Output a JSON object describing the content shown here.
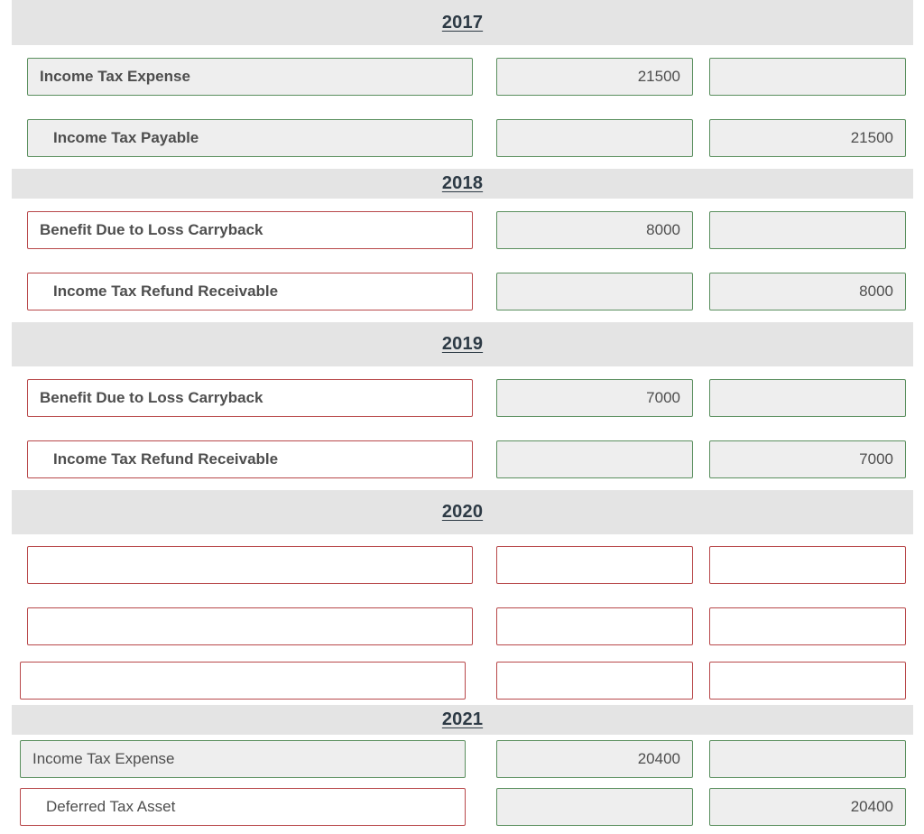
{
  "colors": {
    "correct_border": "#5a8f5e",
    "incorrect_border": "#b8484a",
    "band_background": "#e4e4e4",
    "filled_background": "#eeeeee"
  },
  "sections": [
    {
      "year": "2017",
      "entries": [
        {
          "account": "Income Tax Expense",
          "debit": "21500",
          "credit": "",
          "account_status": "correct",
          "debit_status": "correct",
          "credit_status": "correct"
        },
        {
          "account": "Income Tax Payable",
          "debit": "",
          "credit": "21500",
          "account_status": "correct",
          "debit_status": "correct",
          "credit_status": "correct"
        }
      ]
    },
    {
      "year": "2018",
      "entries": [
        {
          "account": "Benefit Due to Loss Carryback",
          "debit": "8000",
          "credit": "",
          "account_status": "incorrect",
          "debit_status": "correct",
          "credit_status": "correct"
        },
        {
          "account": "Income Tax Refund Receivable",
          "debit": "",
          "credit": "8000",
          "account_status": "incorrect",
          "debit_status": "correct",
          "credit_status": "correct"
        }
      ]
    },
    {
      "year": "2019",
      "entries": [
        {
          "account": "Benefit Due to Loss Carryback",
          "debit": "7000",
          "credit": "",
          "account_status": "incorrect",
          "debit_status": "correct",
          "credit_status": "correct"
        },
        {
          "account": "Income Tax Refund Receivable",
          "debit": "",
          "credit": "7000",
          "account_status": "incorrect",
          "debit_status": "correct",
          "credit_status": "correct"
        }
      ]
    },
    {
      "year": "2020",
      "entries": [
        {
          "account": "",
          "debit": "",
          "credit": "",
          "account_status": "incorrect",
          "debit_status": "incorrect",
          "credit_status": "incorrect"
        },
        {
          "account": "",
          "debit": "",
          "credit": "",
          "account_status": "incorrect",
          "debit_status": "incorrect",
          "credit_status": "incorrect"
        },
        {
          "account": "",
          "debit": "",
          "credit": "",
          "account_status": "incorrect",
          "debit_status": "incorrect",
          "credit_status": "incorrect"
        }
      ]
    },
    {
      "year": "2021",
      "entries": [
        {
          "account": "Income Tax Expense",
          "debit": "20400",
          "credit": "",
          "account_status": "correct",
          "debit_status": "correct",
          "credit_status": "correct"
        },
        {
          "account": "Deferred Tax Asset",
          "debit": "",
          "credit": "20400",
          "account_status": "incorrect",
          "debit_status": "correct",
          "credit_status": "correct"
        }
      ]
    }
  ]
}
